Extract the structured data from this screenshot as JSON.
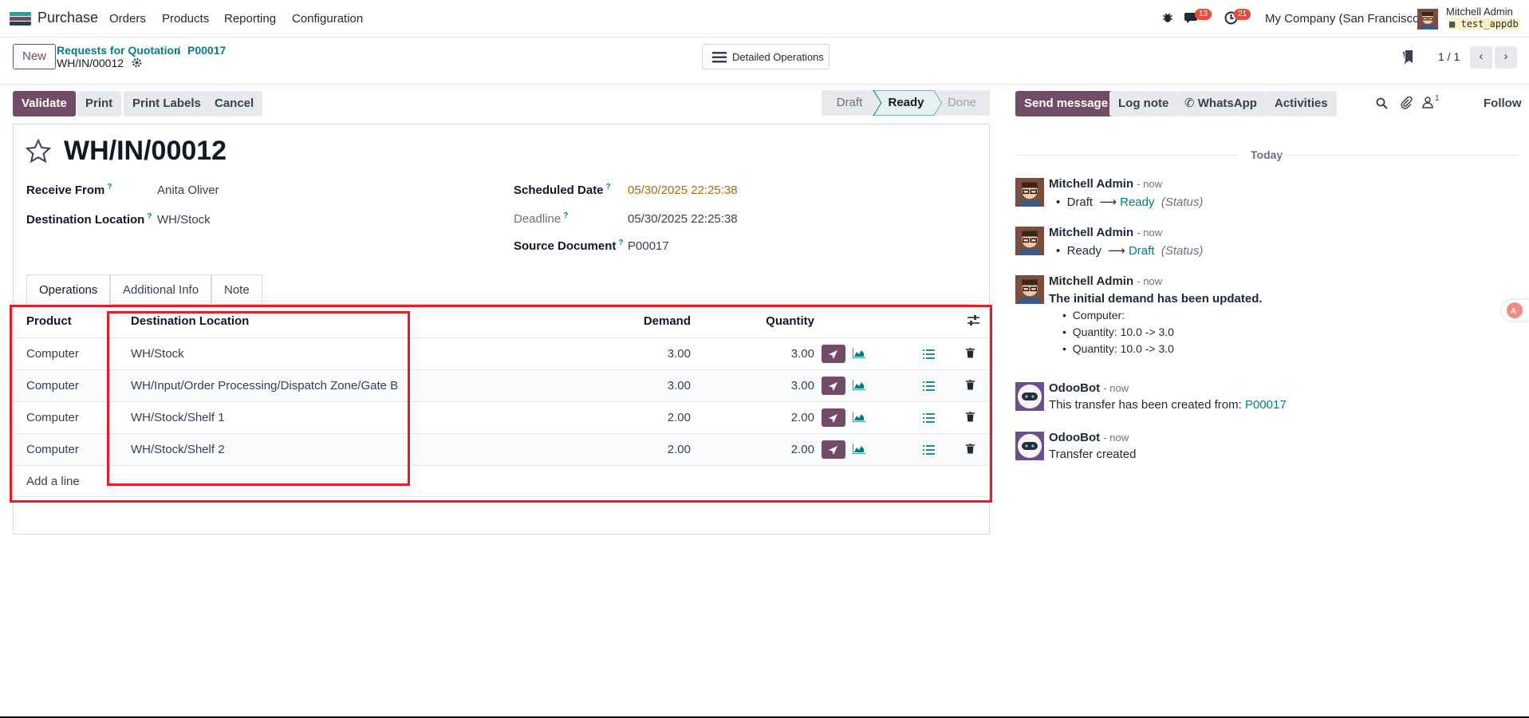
{
  "nav": {
    "app_name": "Purchase",
    "menu": [
      "Orders",
      "Products",
      "Reporting",
      "Configuration"
    ],
    "chat_badge": "13",
    "activity_badge": "21",
    "company": "My Company (San Francisco)",
    "user_name": "Mitchell Admin",
    "db_name": "test_appdb"
  },
  "control": {
    "new_label": "New",
    "breadcrumb_parent": "Requests for Quotation",
    "breadcrumb_sep": "/",
    "breadcrumb_current": "P00017",
    "record_name": "WH/IN/00012",
    "detailed_ops": "Detailed Operations",
    "pager": "1 / 1"
  },
  "actions": {
    "validate": "Validate",
    "print": "Print",
    "print_labels": "Print Labels",
    "cancel": "Cancel"
  },
  "statusbar": [
    "Draft",
    "Ready",
    "Done"
  ],
  "form": {
    "title": "WH/IN/00012",
    "receive_from_label": "Receive From",
    "receive_from": "Anita Oliver",
    "dest_label": "Destination Location",
    "dest": "WH/Stock",
    "scheduled_label": "Scheduled Date",
    "scheduled": "05/30/2025 22:25:38",
    "deadline_label": "Deadline",
    "deadline": "05/30/2025 22:25:38",
    "source_label": "Source Document",
    "source": "P00017",
    "help": "?"
  },
  "tabs": [
    "Operations",
    "Additional Info",
    "Note"
  ],
  "table": {
    "headers": [
      "Product",
      "Destination Location",
      "Demand",
      "Quantity"
    ],
    "rows": [
      {
        "product": "Computer",
        "location": "WH/Stock",
        "demand": "3.00",
        "quantity": "3.00"
      },
      {
        "product": "Computer",
        "location": "WH/Input/Order Processing/Dispatch Zone/Gate B",
        "demand": "3.00",
        "quantity": "3.00"
      },
      {
        "product": "Computer",
        "location": "WH/Stock/Shelf 1",
        "demand": "2.00",
        "quantity": "2.00"
      },
      {
        "product": "Computer",
        "location": "WH/Stock/Shelf 2",
        "demand": "2.00",
        "quantity": "2.00"
      }
    ],
    "add_line": "Add a line"
  },
  "chatter": {
    "send_message": "Send message",
    "log_note": "Log note",
    "whatsapp": "WhatsApp",
    "activities": "Activities",
    "followers_count": "1",
    "follow": "Follow",
    "today": "Today",
    "messages": [
      {
        "author": "Mitchell Admin",
        "time": "- now",
        "from": "Draft",
        "to": "Ready",
        "field": "(Status)"
      },
      {
        "author": "Mitchell Admin",
        "time": "- now",
        "from": "Ready",
        "to": "Draft",
        "field": "(Status)"
      },
      {
        "author": "Mitchell Admin",
        "time": "- now",
        "body": "The initial demand has been updated.",
        "items": [
          "Computer:",
          "Quantity: 10.0 -> 3.0",
          "Quantity: 10.0 -> 3.0"
        ]
      },
      {
        "author": "OdooBot",
        "time": "- now",
        "body": "This transfer has been created from:",
        "link": "P00017"
      },
      {
        "author": "OdooBot",
        "time": "- now",
        "body": "Transfer created"
      }
    ]
  },
  "colors": {
    "brand": "#714b67",
    "link": "#017e84",
    "highlight": "#e11d2a",
    "scheduled": "#a66c0b"
  }
}
